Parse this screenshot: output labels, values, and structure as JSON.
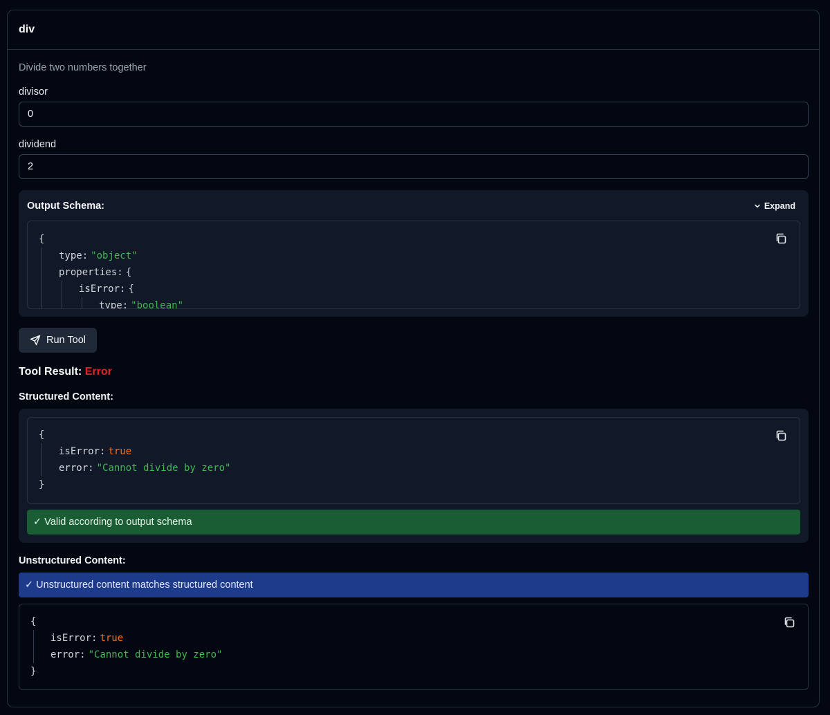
{
  "panel": {
    "title": "div",
    "description": "Divide two numbers together"
  },
  "fields": {
    "divisor": {
      "label": "divisor",
      "value": "0"
    },
    "dividend": {
      "label": "dividend",
      "value": "2"
    }
  },
  "output_schema": {
    "title": "Output Schema:",
    "expand_label": "Expand",
    "lines": [
      {
        "depth": 0,
        "text": "{"
      },
      {
        "depth": 1,
        "key": "type",
        "value": "\"object\"",
        "kind": "string"
      },
      {
        "depth": 1,
        "key": "properties",
        "value": "{",
        "kind": "punct"
      },
      {
        "depth": 2,
        "key": "isError",
        "value": "{",
        "kind": "punct"
      },
      {
        "depth": 3,
        "key": "type",
        "value": "\"boolean\"",
        "kind": "string"
      }
    ]
  },
  "run_button": {
    "label": "Run Tool"
  },
  "result": {
    "prefix": "Tool Result:",
    "status": "Error",
    "status_color": "#dc2626"
  },
  "structured": {
    "title": "Structured Content:",
    "lines": [
      {
        "depth": 0,
        "text": "{"
      },
      {
        "depth": 1,
        "key": "isError",
        "value": "true",
        "kind": "bool"
      },
      {
        "depth": 1,
        "key": "error",
        "value": "\"Cannot divide by zero\"",
        "kind": "string"
      },
      {
        "depth": 0,
        "text": "}"
      }
    ],
    "valid_text": "✓ Valid according to output schema"
  },
  "unstructured": {
    "title": "Unstructured Content:",
    "match_text": "✓ Unstructured content matches structured content",
    "lines": [
      {
        "depth": 0,
        "text": "{"
      },
      {
        "depth": 1,
        "key": "isError",
        "value": "true",
        "kind": "bool"
      },
      {
        "depth": 1,
        "key": "error",
        "value": "\"Cannot divide by zero\"",
        "kind": "string"
      },
      {
        "depth": 0,
        "text": "}"
      }
    ]
  },
  "colors": {
    "background": "#030712",
    "card": "#111827",
    "string": "#3fb950",
    "boolean": "#f97316",
    "valid_banner": "#1a5c33",
    "match_banner": "#1e3a8a"
  },
  "icons": {
    "copy": "copy-icon",
    "send": "send-icon",
    "chevron": "chevron-down-icon"
  }
}
